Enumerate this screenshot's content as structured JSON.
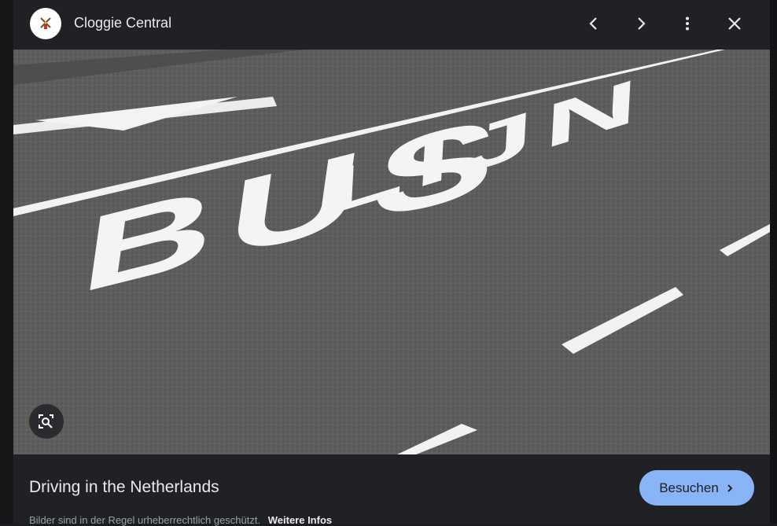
{
  "header": {
    "site_name": "Cloggie Central",
    "logo_icon": "windmill-icon",
    "prev_icon": "chevron-left-icon",
    "next_icon": "chevron-right-icon",
    "more_icon": "more-vert-icon",
    "close_icon": "close-icon"
  },
  "image": {
    "road_text_top": "LIJN",
    "road_text_bottom": "BUS",
    "lens_icon": "lens-search-icon"
  },
  "caption": {
    "title": "Driving in the Netherlands",
    "visit_label": "Besuchen"
  },
  "footer": {
    "copyright_note": "Bilder sind in der Regel urheberrechtlich geschützt.",
    "more_info_link": "Weitere Infos"
  },
  "colors": {
    "panel_bg": "#202124",
    "accent_button": "#8ab4f8",
    "text_primary": "#e8eaed",
    "text_secondary": "#9aa0a6"
  }
}
